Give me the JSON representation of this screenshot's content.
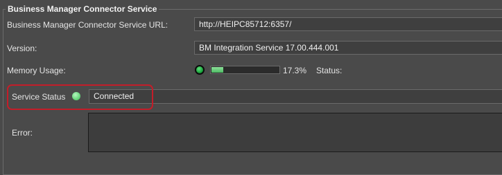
{
  "group": {
    "title": "Business Manager Connector Service"
  },
  "url": {
    "label": "Business Manager Connector Service URL:",
    "value": "http://HEIPC85712:6357/"
  },
  "version": {
    "label": "Version:",
    "value": "BM Integration Service 17.00.444.001"
  },
  "memory": {
    "label": "Memory Usage:",
    "percent_text": "17.3%",
    "fraction": 0.173,
    "status_label": "Status:"
  },
  "service": {
    "label": "Service Status",
    "value": "Connected"
  },
  "error": {
    "label": "Error:",
    "value": ""
  },
  "colors": {
    "highlight": "#c41d29",
    "led_on": "#5dcf72",
    "progress": "#6fcf82"
  }
}
